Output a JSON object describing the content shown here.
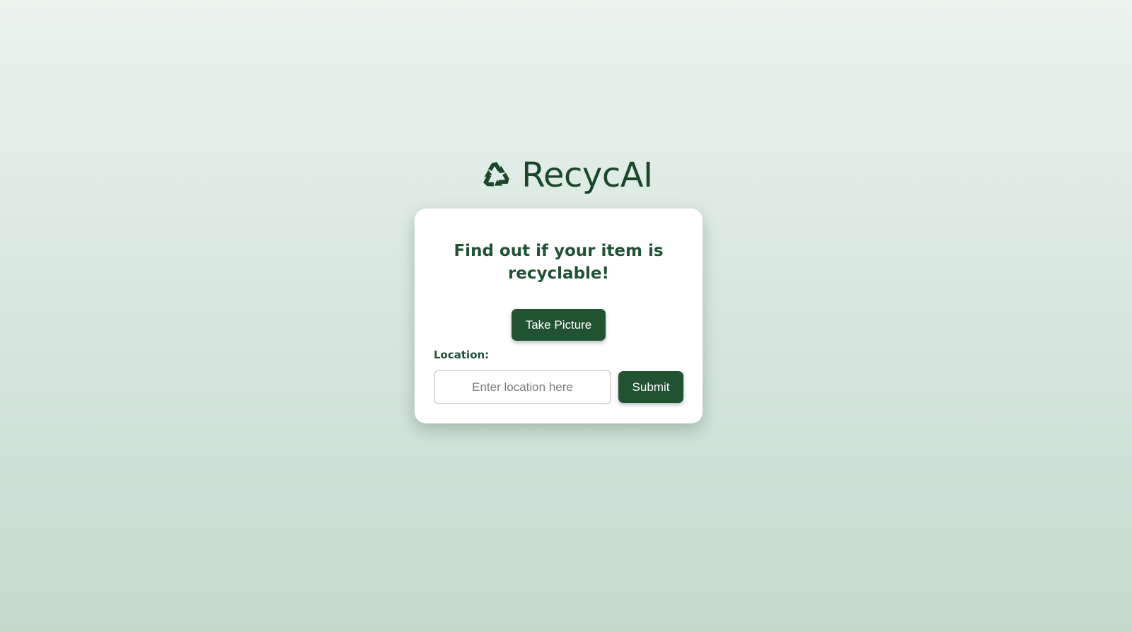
{
  "brand": {
    "name": "RecycAI",
    "icon": "recycle-icon",
    "color": "#1a4729"
  },
  "card": {
    "title": "Find out if your item is recyclable!",
    "take_picture_label": "Take Picture",
    "location_label": "Location:",
    "location_placeholder": "Enter location here",
    "location_value": "",
    "submit_label": "Submit"
  },
  "colors": {
    "accent": "#215232",
    "heading": "#205234"
  }
}
